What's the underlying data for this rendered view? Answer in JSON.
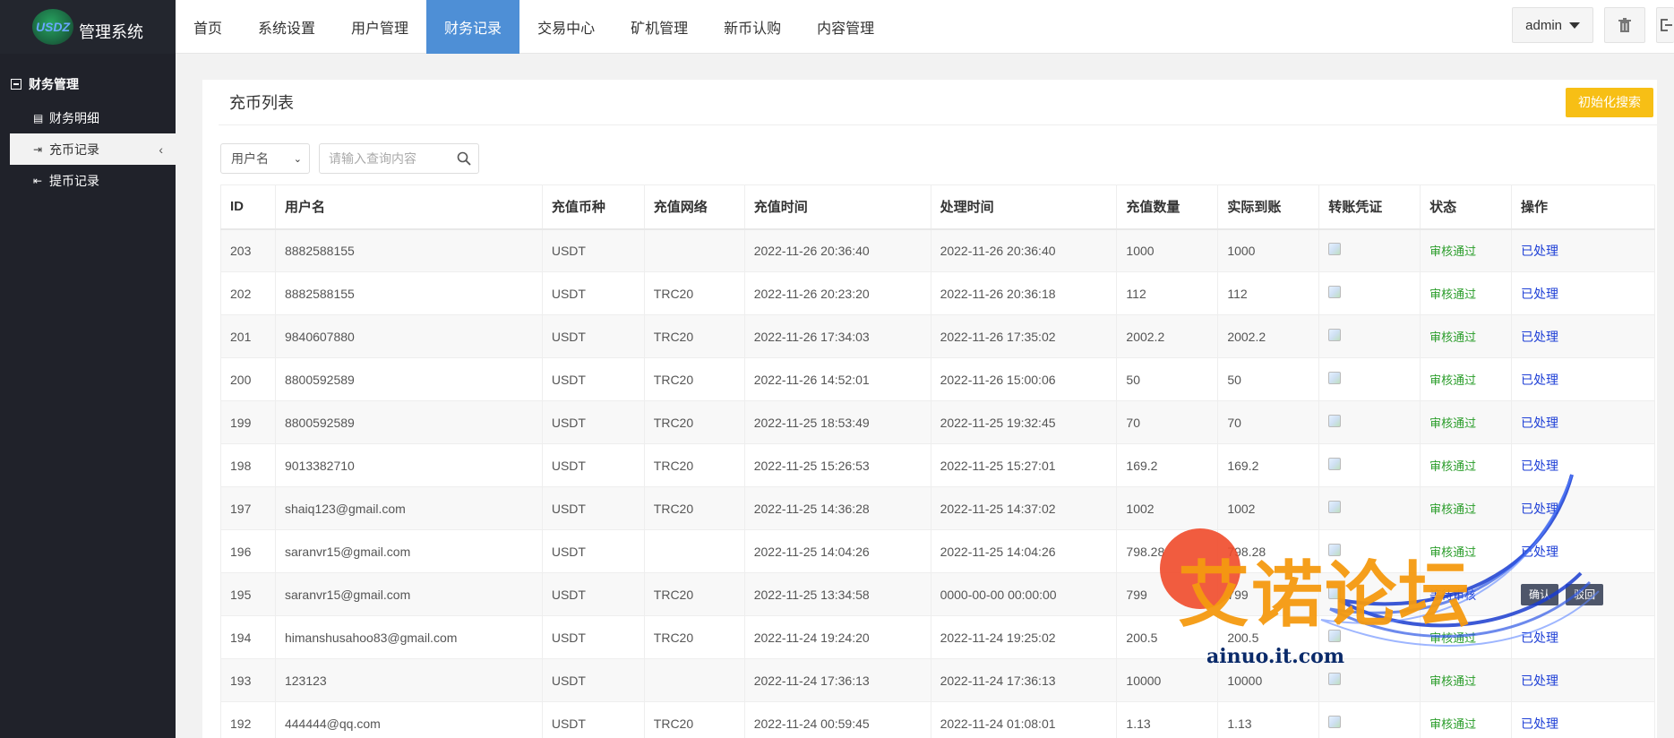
{
  "logo": {
    "mark": "USDZ",
    "title": "管理系统"
  },
  "sidebar": {
    "group_title": "财务管理",
    "items": [
      {
        "label": "财务明细"
      },
      {
        "label": "充币记录"
      },
      {
        "label": "提币记录"
      }
    ]
  },
  "topnav": {
    "tabs": [
      {
        "label": "首页"
      },
      {
        "label": "系统设置"
      },
      {
        "label": "用户管理"
      },
      {
        "label": "财务记录"
      },
      {
        "label": "交易中心"
      },
      {
        "label": "矿机管理"
      },
      {
        "label": "新币认购"
      },
      {
        "label": "内容管理"
      }
    ],
    "active_tab": "财务记录",
    "user_label": "admin"
  },
  "page": {
    "title": "充币列表",
    "reset_button": "初始化搜索",
    "filter_select": "用户名",
    "search_placeholder": "请输入查询内容"
  },
  "table": {
    "headers": [
      "ID",
      "用户名",
      "充值币种",
      "充值网络",
      "充值时间",
      "处理时间",
      "充值数量",
      "实际到账",
      "转账凭证",
      "状态",
      "操作"
    ],
    "rows": [
      {
        "id": "203",
        "user": "8882588155",
        "coin": "USDT",
        "net": "",
        "time": "2022-11-26 20:36:40",
        "proc": "2022-11-26 20:36:40",
        "amount": "1000",
        "actual": "1000",
        "status": "审核通过",
        "action": "已处理"
      },
      {
        "id": "202",
        "user": "8882588155",
        "coin": "USDT",
        "net": "TRC20",
        "time": "2022-11-26 20:23:20",
        "proc": "2022-11-26 20:36:18",
        "amount": "112",
        "actual": "112",
        "status": "审核通过",
        "action": "已处理"
      },
      {
        "id": "201",
        "user": "9840607880",
        "coin": "USDT",
        "net": "TRC20",
        "time": "2022-11-26 17:34:03",
        "proc": "2022-11-26 17:35:02",
        "amount": "2002.2",
        "actual": "2002.2",
        "status": "审核通过",
        "action": "已处理"
      },
      {
        "id": "200",
        "user": "8800592589",
        "coin": "USDT",
        "net": "TRC20",
        "time": "2022-11-26 14:52:01",
        "proc": "2022-11-26 15:00:06",
        "amount": "50",
        "actual": "50",
        "status": "审核通过",
        "action": "已处理"
      },
      {
        "id": "199",
        "user": "8800592589",
        "coin": "USDT",
        "net": "TRC20",
        "time": "2022-11-25 18:53:49",
        "proc": "2022-11-25 19:32:45",
        "amount": "70",
        "actual": "70",
        "status": "审核通过",
        "action": "已处理"
      },
      {
        "id": "198",
        "user": "9013382710",
        "coin": "USDT",
        "net": "TRC20",
        "time": "2022-11-25 15:26:53",
        "proc": "2022-11-25 15:27:01",
        "amount": "169.2",
        "actual": "169.2",
        "status": "审核通过",
        "action": "已处理"
      },
      {
        "id": "197",
        "user": "shaiq123@gmail.com",
        "coin": "USDT",
        "net": "TRC20",
        "time": "2022-11-25 14:36:28",
        "proc": "2022-11-25 14:37:02",
        "amount": "1002",
        "actual": "1002",
        "status": "审核通过",
        "action": "已处理"
      },
      {
        "id": "196",
        "user": "saranvr15@gmail.com",
        "coin": "USDT",
        "net": "",
        "time": "2022-11-25 14:04:26",
        "proc": "2022-11-25 14:04:26",
        "amount": "798.28",
        "actual": "798.28",
        "status": "审核通过",
        "action": "已处理"
      },
      {
        "id": "195",
        "user": "saranvr15@gmail.com",
        "coin": "USDT",
        "net": "TRC20",
        "time": "2022-11-25 13:34:58",
        "proc": "0000-00-00 00:00:00",
        "amount": "799",
        "actual": "799",
        "status": "等待审核",
        "action_confirm": "确认",
        "action_reject": "驳回"
      },
      {
        "id": "194",
        "user": "himanshusahoo83@gmail.com",
        "coin": "USDT",
        "net": "TRC20",
        "time": "2022-11-24 19:24:20",
        "proc": "2022-11-24 19:25:02",
        "amount": "200.5",
        "actual": "200.5",
        "status": "审核通过",
        "action": "已处理"
      },
      {
        "id": "193",
        "user": "123123",
        "coin": "USDT",
        "net": "",
        "time": "2022-11-24 17:36:13",
        "proc": "2022-11-24 17:36:13",
        "amount": "10000",
        "actual": "10000",
        "status": "审核通过",
        "action": "已处理"
      },
      {
        "id": "192",
        "user": "444444@qq.com",
        "coin": "USDT",
        "net": "TRC20",
        "time": "2022-11-24 00:59:45",
        "proc": "2022-11-24 01:08:01",
        "amount": "1.13",
        "actual": "1.13",
        "status": "审核通过",
        "action": "已处理"
      }
    ]
  },
  "watermark": {
    "text": "艾诺论坛",
    "url": "ainuo.it.com"
  },
  "icons": {
    "trash": "trash-icon",
    "exit": "exit-icon",
    "search": "search-icon"
  }
}
